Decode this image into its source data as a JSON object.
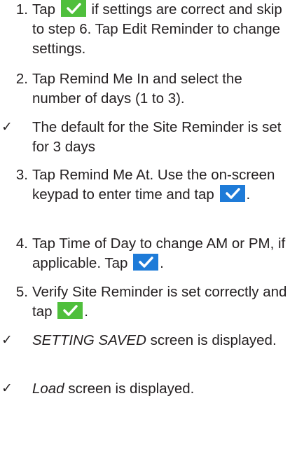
{
  "icons": {
    "confirm_green": "check-icon-green",
    "confirm_blue": "check-icon-blue"
  },
  "colors": {
    "text": "#231f20",
    "green_button": "#4fbf3c",
    "blue_button": "#1e7bd8"
  },
  "steps": [
    {
      "num": "1.",
      "a": "Tap",
      "b": "if settings are correct and skip to step 6. Tap",
      "c": "Edit Reminder",
      "d": "to change settings."
    },
    {
      "num": "2.",
      "a": "Tap",
      "b": "Remind Me In",
      "c": "and select the number of days (1 to 3)."
    },
    {
      "tick": "✓",
      "text": "The default for the Site Reminder is set for 3 days"
    },
    {
      "num": "3.",
      "a": "Tap",
      "b": "Remind Me At",
      "c": ". Use the on-screen keypad to enter time and tap",
      "d": "."
    },
    {
      "num": "4.",
      "a": "Tap",
      "b": "Time of Day",
      "c": "to change AM or PM, if applicable. Tap",
      "d": "."
    },
    {
      "num": "5.",
      "a": "Verify Site Reminder is set correctly and tap",
      "b": "."
    },
    {
      "tick": "✓",
      "em": "SETTING SAVED",
      "text": "screen is displayed."
    },
    {
      "tick": "✓",
      "em": "Load",
      "text": "screen is displayed."
    }
  ]
}
